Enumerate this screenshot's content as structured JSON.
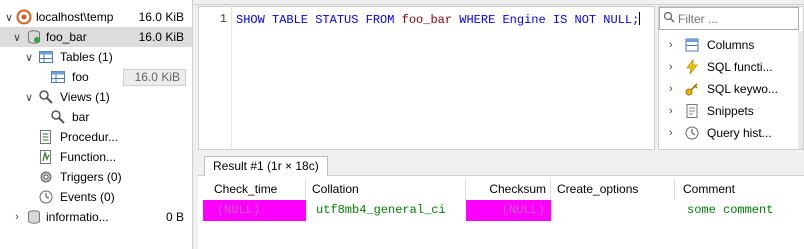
{
  "tree": {
    "items": [
      {
        "label": "localhost\\temp",
        "size": "16.0 KiB"
      },
      {
        "label": "foo_bar",
        "size": "16.0 KiB"
      },
      {
        "label": "Tables (1)",
        "size": ""
      },
      {
        "label": "foo",
        "size": "16.0 KiB"
      },
      {
        "label": "Views (1)",
        "size": ""
      },
      {
        "label": "bar",
        "size": ""
      },
      {
        "label": "Procedur...",
        "size": ""
      },
      {
        "label": "Function...",
        "size": ""
      },
      {
        "label": "Triggers (0)",
        "size": ""
      },
      {
        "label": "Events (0)",
        "size": ""
      },
      {
        "label": "informatio...",
        "size": "0 B"
      }
    ]
  },
  "editor": {
    "line_number": "1",
    "tokens": {
      "show": "SHOW TABLE STATUS FROM ",
      "table": "foo_bar",
      "where": " WHERE ",
      "engine": "Engine IS NOT NULL;"
    }
  },
  "helper": {
    "filter_placeholder": "Filter ...",
    "items": [
      {
        "label": "Columns",
        "icon": "columns-icon"
      },
      {
        "label": "SQL functi...",
        "icon": "sql-functions-icon"
      },
      {
        "label": "SQL keywo...",
        "icon": "sql-keywords-icon"
      },
      {
        "label": "Snippets",
        "icon": "snippets-icon"
      },
      {
        "label": "Query hist...",
        "icon": "query-history-icon"
      }
    ]
  },
  "results": {
    "tab_label": "Result #1 (1r × 18c)",
    "columns": [
      "Check_time",
      "Collation",
      "Checksum",
      "Create_options",
      "Comment"
    ],
    "row": [
      "(NULL)",
      "utf8mb4_general_ci",
      "(NULL)",
      "",
      "some comment"
    ]
  },
  "colors": {
    "null_cell": "#ff00ff",
    "keyword": "#0000ff",
    "table_name": "#8b0000",
    "string_value": "#008000"
  }
}
